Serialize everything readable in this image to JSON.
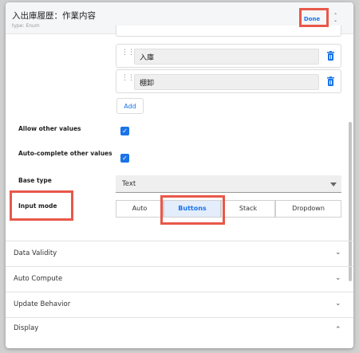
{
  "header": {
    "title": "入出庫履歴：作業内容",
    "subtitle": "type: Enum",
    "done_label": "Done"
  },
  "values": [
    {
      "label": "入庫"
    },
    {
      "label": "棚卸"
    }
  ],
  "add_label": "Add",
  "fields": {
    "allow_other_label": "Allow other values",
    "allow_other_checked": true,
    "autocomplete_label": "Auto-complete other values",
    "autocomplete_checked": true,
    "base_type_label": "Base type",
    "base_type_value": "Text",
    "input_mode_label": "Input mode"
  },
  "input_modes": [
    {
      "label": "Auto",
      "selected": false
    },
    {
      "label": "Buttons",
      "selected": true
    },
    {
      "label": "Stack",
      "selected": false
    },
    {
      "label": "Dropdown",
      "selected": false
    }
  ],
  "sections": [
    {
      "label": "Data Validity",
      "expanded": false
    },
    {
      "label": "Auto Compute",
      "expanded": false
    },
    {
      "label": "Update Behavior",
      "expanded": false
    },
    {
      "label": "Display",
      "expanded": true
    }
  ],
  "colors": {
    "accent": "#1a73e8",
    "highlight": "#e8584a",
    "selected_bg": "#e3edfc"
  }
}
